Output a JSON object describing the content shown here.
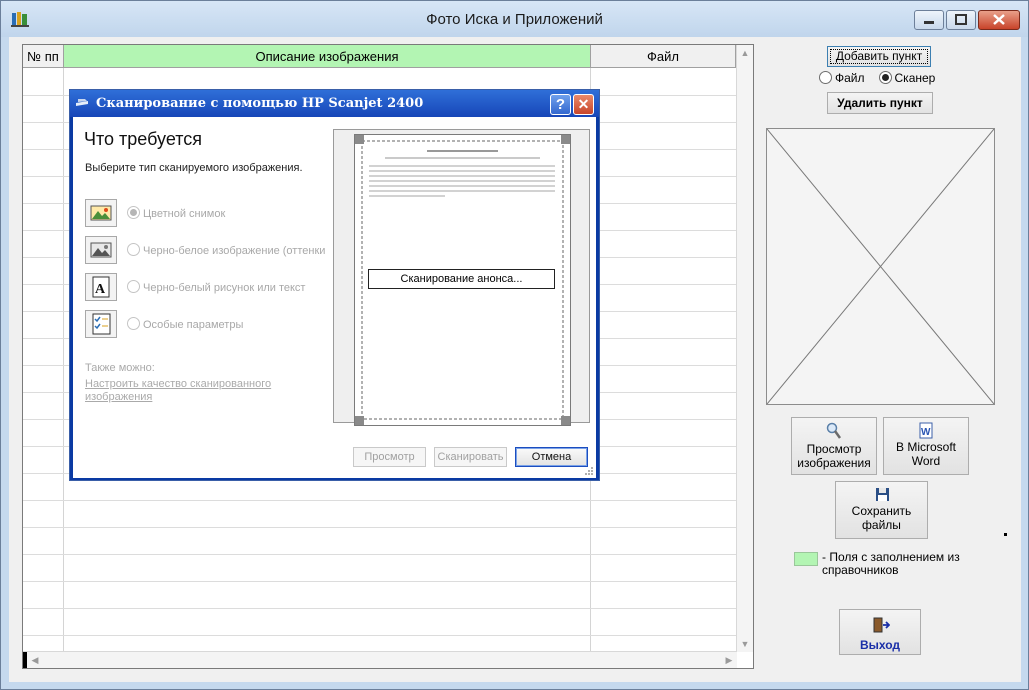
{
  "window": {
    "title": "Фото Иска и Приложений"
  },
  "grid": {
    "columns": [
      {
        "label": "№ пп"
      },
      {
        "label": "Описание изображения"
      },
      {
        "label": "Файл"
      }
    ]
  },
  "panel": {
    "add_button": "Добавить пункт",
    "source_options": [
      {
        "label": "Файл",
        "selected": false
      },
      {
        "label": "Сканер",
        "selected": true
      }
    ],
    "remove_button": "Удалить пункт",
    "view_button": "Просмотр изображения",
    "word_button": "В Microsoft Word",
    "save_button": "Сохранить файлы",
    "legend_text": "-  Поля с заполнением из справочников",
    "exit_button": "Выход",
    "legend_color": "#b3f5b3"
  },
  "dialog": {
    "title": "Сканирование с помощью HP Scanjet 2400",
    "heading": "Что требуется",
    "subtitle": "Выберите тип сканируемого изображения.",
    "options": [
      {
        "label": "Цветной снимок",
        "selected": true,
        "icon": "color-photo-icon"
      },
      {
        "label": "Черно-белое изображение (оттенки",
        "selected": false,
        "icon": "grayscale-photo-icon"
      },
      {
        "label": "Черно-белый рисунок или текст",
        "selected": false,
        "icon": "text-drawing-icon"
      },
      {
        "label": "Особые параметры",
        "selected": false,
        "icon": "custom-settings-icon"
      }
    ],
    "also_label": "Также можно:",
    "quality_link": "Настроить качество сканированного изображения",
    "scan_status": "Сканирование анонса...",
    "preview_button": "Просмотр",
    "scan_button": "Сканировать",
    "cancel_button": "Отмена",
    "help_symbol": "?",
    "close_symbol": "✕"
  }
}
